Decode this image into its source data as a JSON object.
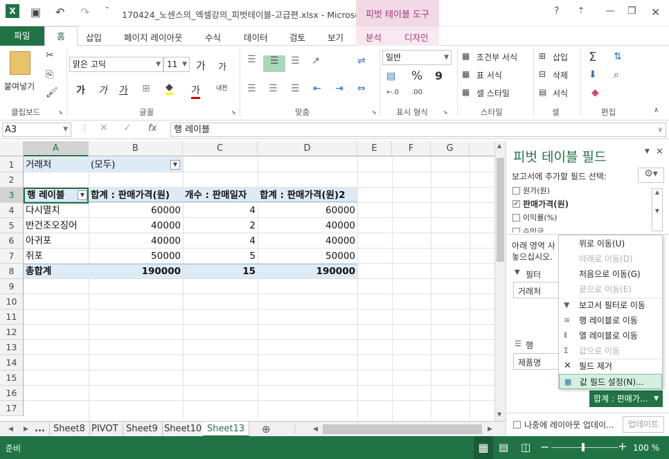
{
  "window": {
    "title": "170424_노센스의_엑셀강의_피벗테이블-고급편.xlsx - Microso...",
    "context_tab": "피벗 테이블 도구",
    "help": "?"
  },
  "tabs": [
    "파일",
    "홈",
    "삽입",
    "페이지 레이아웃",
    "수식",
    "데이터",
    "검토",
    "보기",
    "분석",
    "디자인"
  ],
  "ribbon": {
    "clipboard": {
      "paste": "붙여넣기",
      "label": "클립보드"
    },
    "font": {
      "name": "맑은 고딕",
      "size": "11",
      "label": "글꼴",
      "grow": "가",
      "shrink": "가",
      "bold": "가",
      "italic": "가",
      "underline": "가",
      "color_a": "가",
      "phonetic": "내천"
    },
    "align": {
      "label": "맞춤"
    },
    "number": {
      "format": "일반",
      "label": "표시 형식",
      "percent": "%",
      "comma": "9"
    },
    "styles": {
      "cond": "조건부 서식",
      "table": "표 서식",
      "cell": "셀 스타일",
      "label": "스타일"
    },
    "cells": {
      "insert": "삽입",
      "delete": "삭제",
      "format": "서식",
      "label": "셀"
    },
    "editing": {
      "label": "편집"
    }
  },
  "formula_bar": {
    "name_box": "A3",
    "fx": "fx",
    "value": "행 레이블"
  },
  "columns": [
    "A",
    "B",
    "C",
    "D",
    "E",
    "F",
    "G"
  ],
  "rows": [
    "1",
    "2",
    "3",
    "4",
    "5",
    "6",
    "7",
    "8",
    "9",
    "10",
    "11",
    "12",
    "13",
    "14",
    "15",
    "16",
    "17"
  ],
  "pivot": {
    "filter_label": "거래처",
    "filter_value": "(모두)",
    "headers": [
      "행 레이블",
      "합계 : 판매가격(원)",
      "개수 : 판매일자",
      "합계 : 판매가격(원)2"
    ],
    "data": [
      [
        "다시멸치",
        "60000",
        "4",
        "60000"
      ],
      [
        "반건조오징어",
        "40000",
        "2",
        "40000"
      ],
      [
        "아귀포",
        "40000",
        "4",
        "40000"
      ],
      [
        "쥐포",
        "50000",
        "5",
        "50000"
      ]
    ],
    "total": [
      "총합계",
      "190000",
      "15",
      "190000"
    ]
  },
  "sheet_tabs": [
    "...",
    "Sheet8",
    "PIVOT",
    "Sheet9",
    "Sheet10",
    "Sheet13"
  ],
  "status": {
    "ready": "준비",
    "zoom": "100 %"
  },
  "pane": {
    "title": "피벗 테이블 필드",
    "choose": "보고서에 추가할 필드 선택:",
    "fields": [
      {
        "name": "원가(원)",
        "checked": false
      },
      {
        "name": "판매가격(원)",
        "checked": true
      },
      {
        "name": "이익률(%)",
        "checked": false
      },
      {
        "name": "수익금",
        "checked": false
      }
    ],
    "drag_hint_1": "아래 영역 사",
    "drag_hint_2": "놓으십시오.",
    "filter_area": "필터",
    "filter_item": "거래처",
    "row_area": "행",
    "row_item": "제품명",
    "value_button": "합계 : 판매가...",
    "defer": "나중에 레이아웃 업데이...",
    "update": "업데이트"
  },
  "menu": [
    {
      "label": "위로 이동(U)",
      "enabled": true,
      "icon": ""
    },
    {
      "label": "아래로 이동(D)",
      "enabled": false,
      "icon": ""
    },
    {
      "label": "처음으로 이동(G)",
      "enabled": true,
      "icon": ""
    },
    {
      "label": "끝으로 이동(E)",
      "enabled": false,
      "icon": ""
    },
    {
      "label": "보고서 필터로 이동",
      "enabled": true,
      "icon": "▼"
    },
    {
      "label": "행 레이블로 이동",
      "enabled": true,
      "icon": "≡"
    },
    {
      "label": "열 레이블로 이동",
      "enabled": true,
      "icon": "⦀"
    },
    {
      "label": "값으로 이동",
      "enabled": false,
      "icon": "Σ"
    },
    {
      "label": "필드 제거",
      "enabled": true,
      "icon": "✕"
    },
    {
      "label": "값 필드 설정(N)...",
      "enabled": true,
      "icon": "▦",
      "highlight": true
    }
  ],
  "colors": {
    "brand": "#217346",
    "pivot_band": "#ddebf7",
    "context": "#a33b73"
  }
}
